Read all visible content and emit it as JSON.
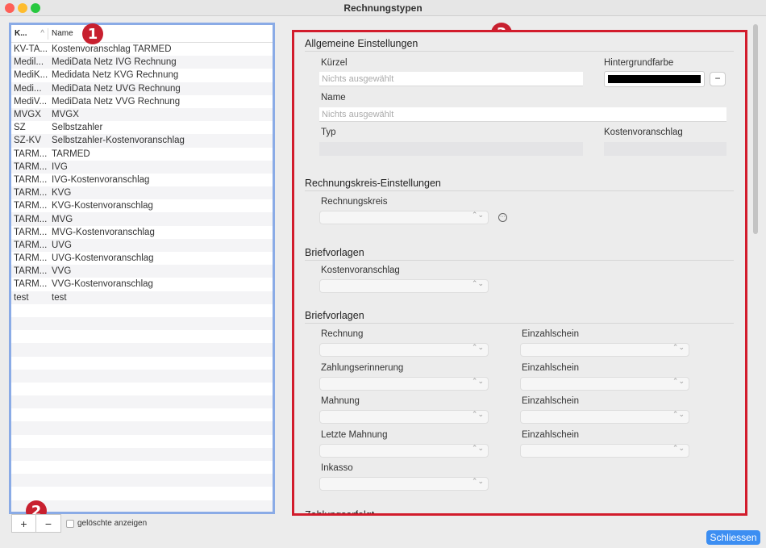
{
  "window": {
    "title": "Rechnungstypen"
  },
  "list": {
    "col1_header": "K...",
    "col2_header": "Name",
    "rows": [
      {
        "code": "KV-TA...",
        "name": "Kostenvoranschlag TARMED"
      },
      {
        "code": "Medil...",
        "name": "MediData Netz IVG Rechnung"
      },
      {
        "code": "MediK...",
        "name": "Medidata Netz KVG Rechnung"
      },
      {
        "code": "Medi...",
        "name": "MediData Netz UVG Rechnung"
      },
      {
        "code": "MediV...",
        "name": "MediData Netz VVG Rechnung"
      },
      {
        "code": "MVGX",
        "name": "MVGX"
      },
      {
        "code": "SZ",
        "name": "Selbstzahler"
      },
      {
        "code": "SZ-KV",
        "name": "Selbstzahler-Kostenvoranschlag"
      },
      {
        "code": "TARM...",
        "name": "TARMED"
      },
      {
        "code": "TARM...",
        "name": "IVG"
      },
      {
        "code": "TARM...",
        "name": "IVG-Kostenvoranschlag"
      },
      {
        "code": "TARM...",
        "name": "KVG"
      },
      {
        "code": "TARM...",
        "name": "KVG-Kostenvoranschlag"
      },
      {
        "code": "TARM...",
        "name": "MVG"
      },
      {
        "code": "TARM...",
        "name": "MVG-Kostenvoranschlag"
      },
      {
        "code": "TARM...",
        "name": "UVG"
      },
      {
        "code": "TARM...",
        "name": "UVG-Kostenvoranschlag"
      },
      {
        "code": "TARM...",
        "name": "VVG"
      },
      {
        "code": "TARM...",
        "name": "VVG-Kostenvoranschlag"
      },
      {
        "code": "test",
        "name": "test"
      }
    ],
    "add_label": "+",
    "remove_label": "−",
    "show_deleted_label": "gelöschte anzeigen"
  },
  "badges": {
    "one": "1",
    "two": "2",
    "three": "3"
  },
  "panel": {
    "general": {
      "title": "Allgemeine Einstellungen",
      "kuerzel_label": "Kürzel",
      "kuerzel_placeholder": "Nichts ausgewählt",
      "bg_color_label": "Hintergrundfarbe",
      "bg_color_value": "#000000",
      "color_remove": "−",
      "name_label": "Name",
      "name_placeholder": "Nichts ausgewählt",
      "typ_label": "Typ",
      "kv_label": "Kostenvoranschlag"
    },
    "circle": {
      "title": "Rechnungskreis-Einstellungen",
      "label": "Rechnungskreis",
      "more": "···"
    },
    "templates1": {
      "title": "Briefvorlagen",
      "kv_label": "Kostenvoranschlag"
    },
    "templates2": {
      "title": "Briefvorlagen",
      "rechnung": "Rechnung",
      "zahlungserinnerung": "Zahlungserinnerung",
      "mahnung": "Mahnung",
      "letzte_mahnung": "Letzte Mahnung",
      "inkasso": "Inkasso",
      "einzahlschein": "Einzahlschein"
    },
    "cut_off_title": "Zahlungsarfolgt"
  },
  "close_button": "Schliessen",
  "select_chevron": "⌃⌄"
}
